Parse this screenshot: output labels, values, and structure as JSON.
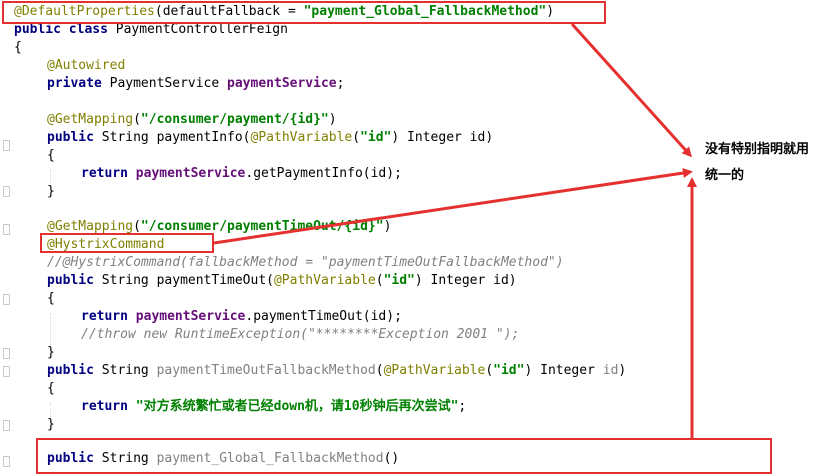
{
  "code": {
    "l1": {
      "ann": "@DefaultProperties",
      "p1": "(defaultFallback = ",
      "str": "\"payment_Global_FallbackMethod\"",
      "p2": ")"
    },
    "l2": {
      "kw": "public class ",
      "rest": "PaymentControllerFeign"
    },
    "l3": {
      "text": "{"
    },
    "l4": {
      "ann": "@Autowired"
    },
    "l5": {
      "kw": "private ",
      "type": "PaymentService ",
      "fld": "paymentService",
      "p": ";"
    },
    "l6": {
      "ann": "@GetMapping",
      "p1": "(",
      "str": "\"/consumer/payment/{id}\"",
      "p2": ")"
    },
    "l7": {
      "kw": "public ",
      "p1": "String paymentInfo(",
      "ann": "@PathVariable",
      "p2": "(",
      "str": "\"id\"",
      "p3": ") Integer id)"
    },
    "l8": {
      "text": "{"
    },
    "l9": {
      "kw": "return ",
      "fld": "paymentService",
      "p": ".getPaymentInfo(id);"
    },
    "l10": {
      "text": "}"
    },
    "l11": {
      "ann": "@GetMapping",
      "p1": "(",
      "str": "\"/consumer/paymentTimeOut/{id}\"",
      "p2": ")"
    },
    "l12": {
      "ann": "@HystrixCommand"
    },
    "l13": {
      "cmt": "//@HystrixCommand(fallbackMethod = \"paymentTimeOutFallbackMethod\")"
    },
    "l14": {
      "kw": "public ",
      "p1": "String paymentTimeOut(",
      "ann": "@PathVariable",
      "p2": "(",
      "str": "\"id\"",
      "p3": ") Integer id)"
    },
    "l15": {
      "text": "{"
    },
    "l16": {
      "kw": "return ",
      "fld": "paymentService",
      "p": ".paymentTimeOut(id);"
    },
    "l17": {
      "cmt": "//throw new RuntimeException(\"********Exception 2001 \");"
    },
    "l18": {
      "text": "}"
    },
    "l19": {
      "kw": "public ",
      "p1": "String ",
      "gray": "paymentTimeOutFallbackMethod",
      "p2": "(",
      "ann": "@PathVariable",
      "p3": "(",
      "str": "\"id\"",
      "p4": ") Integer ",
      "gray2": "id",
      "p5": ")"
    },
    "l20": {
      "text": "{"
    },
    "l21": {
      "kw": "return ",
      "str": "\"对方系统繁忙或者已经down机，请10秒钟后再次尝试\"",
      "p": ";"
    },
    "l22": {
      "text": "}"
    },
    "l23": {
      "kw": "public ",
      "p1": "String ",
      "gray": "payment_Global_FallbackMethod",
      "p2": "()"
    }
  },
  "annotation": {
    "line1": "没有特别指明就用",
    "line2": "统一的"
  },
  "colors": {
    "highlight": "#e53030",
    "keyword": "#000080",
    "annotation": "#808000",
    "string": "#008000",
    "field": "#660e7a",
    "comment": "#808080"
  }
}
